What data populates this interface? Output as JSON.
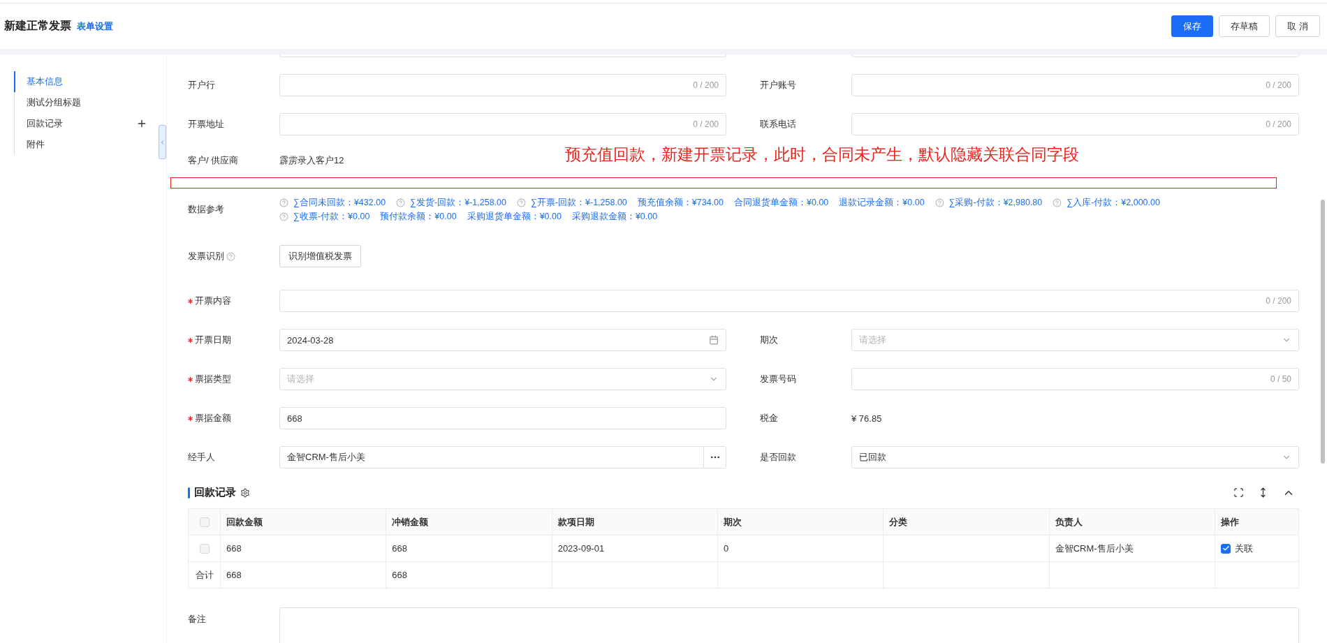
{
  "header": {
    "title": "新建正常发票",
    "link": "表单设置",
    "buttons": [
      {
        "label": "保存",
        "primary": true
      },
      {
        "label": "存草稿",
        "primary": false
      },
      {
        "label": "取 消",
        "primary": false
      }
    ]
  },
  "sidebar": {
    "items": [
      {
        "label": "基本信息",
        "selected": true,
        "addable": false
      },
      {
        "label": "测试分组标题",
        "selected": false,
        "addable": false
      },
      {
        "label": "回款记录",
        "selected": false,
        "addable": true
      },
      {
        "label": "附件",
        "selected": false,
        "addable": false
      }
    ]
  },
  "form": {
    "rows": [
      {
        "kind": "cutoff",
        "cells": [
          {
            "kind": "text"
          },
          {
            "kind": "text"
          }
        ]
      },
      {
        "kind": "fields",
        "cells": [
          {
            "label": "开户行",
            "kind": "text",
            "counter": "0 / 200"
          },
          {
            "label": "开户账号",
            "kind": "text",
            "counter": "0 / 200"
          }
        ]
      },
      {
        "kind": "fields",
        "cells": [
          {
            "label": "开票地址",
            "kind": "text",
            "counter": "0 / 200"
          },
          {
            "label": "联系电话",
            "kind": "text",
            "counter": "0 / 200"
          }
        ]
      },
      {
        "kind": "customer",
        "note": "预充值回款，新建开票记录，此时，合同未产生，默认隐藏关联合同字段",
        "cells": [
          {
            "label": "客户/ 供应商",
            "kind": "static",
            "value": "霹雳录入客户12"
          }
        ]
      },
      {
        "kind": "highlight"
      },
      {
        "kind": "reference",
        "label": "数据参考",
        "lines": [
          [
            {
              "help": true,
              "text": "∑合同未回款：¥432.00"
            },
            {
              "help": true,
              "text": "∑发货-回款：¥-1,258.00"
            },
            {
              "help": true,
              "text": "∑开票-回款：¥-1,258.00"
            },
            {
              "help": false,
              "text": "预充值余额：¥734.00"
            },
            {
              "help": false,
              "text": "合同退货单金额：¥0.00"
            },
            {
              "help": false,
              "text": "退款记录金额：¥0.00"
            },
            {
              "help": true,
              "text": "∑采购-付款：¥2,980.80"
            },
            {
              "help": true,
              "text": "∑入库-付款：¥2,000.00"
            }
          ],
          [
            {
              "help": true,
              "text": "∑收票-付款：¥0.00"
            },
            {
              "help": false,
              "text": "预付款余额：¥0.00"
            },
            {
              "help": false,
              "text": "采购退货单金额：¥0.00"
            },
            {
              "help": false,
              "text": "采购退款金额：¥0.00"
            }
          ]
        ]
      },
      {
        "kind": "recognize",
        "cells": [
          {
            "label": "发票识别",
            "help": true,
            "kind": "button",
            "value": "识别增值税发票"
          }
        ]
      },
      {
        "kind": "fields",
        "cells": [
          {
            "label": "开票内容",
            "required": true,
            "wide": true,
            "kind": "text",
            "counter": "0 / 200"
          }
        ]
      },
      {
        "kind": "fields",
        "cells": [
          {
            "label": "开票日期",
            "required": true,
            "kind": "date",
            "value": "2024-03-28"
          },
          {
            "label": "期次",
            "kind": "select",
            "placeholder": "请选择"
          }
        ]
      },
      {
        "kind": "fields",
        "cells": [
          {
            "label": "票据类型",
            "required": true,
            "kind": "select",
            "placeholder": "请选择"
          },
          {
            "label": "发票号码",
            "kind": "text",
            "counter": "0 / 50"
          }
        ]
      },
      {
        "kind": "fields",
        "cells": [
          {
            "label": "票据金额",
            "required": true,
            "kind": "text",
            "value": "668"
          },
          {
            "label": "税金",
            "kind": "static",
            "value": "¥ 76.85"
          }
        ]
      },
      {
        "kind": "fields",
        "cells": [
          {
            "label": "经手人",
            "kind": "picker",
            "value": "金智CRM-售后小美"
          },
          {
            "label": "是否回款",
            "kind": "select",
            "value": "已回款"
          }
        ]
      }
    ]
  },
  "payments": {
    "title": "回款记录",
    "all_checked": false,
    "columns": [
      "回款金额",
      "冲销金额",
      "款项日期",
      "期次",
      "分类",
      "负责人",
      "操作"
    ],
    "rows": [
      {
        "checked": false,
        "cells": [
          "668",
          "668",
          "2023-09-01",
          "0",
          null,
          "金智CRM-售后小美"
        ],
        "action": {
          "label": "关联",
          "checked": true
        }
      }
    ],
    "total": {
      "label": "合计",
      "cells": [
        "668",
        "668"
      ]
    }
  },
  "remarks": {
    "label": "备注"
  }
}
